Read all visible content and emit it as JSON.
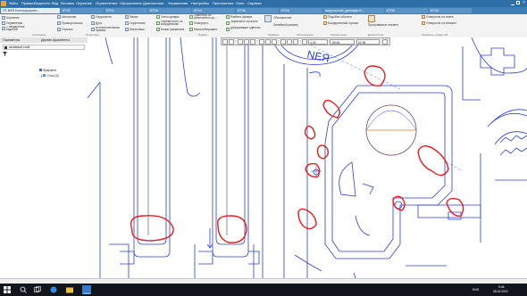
{
  "menubar": {
    "items": [
      "Файл",
      "Правка",
      "Выделить",
      "Вид",
      "Вставка",
      "Черчение",
      "Ограничения",
      "Оформление",
      "Диагностика",
      "Управление",
      "Настройка",
      "Приложения",
      "Окно",
      "Справка"
    ]
  },
  "tabs": [
    {
      "label": "ПТ-ВФП Конструкционн..."
    },
    {
      "label": "КТЭ3"
    },
    {
      "label": "КТЭ1"
    },
    {
      "label": "КТЭ6"
    },
    {
      "label": "КТЭ4"
    },
    {
      "label": "КТЭ6"
    },
    {
      "label": "КТЭ4"
    },
    {
      "label": "нагрузочный_демпфер К..."
    },
    {
      "label": "КТЭ5"
    },
    {
      "label": "КТЭ4"
    }
  ],
  "ribbon": {
    "left_tools": [
      "Черчение",
      "Управление",
      "Стандартные изделия"
    ],
    "col1": [
      "Автолиния",
      "Прямоугольник",
      "Отрезок"
    ],
    "col2": [
      "Окружность",
      "Дуга",
      "Вспомогательная прямая"
    ],
    "col3": [
      "Фаска",
      "Скругление",
      "Штриховка"
    ],
    "col4": [
      "Усечь кривую",
      "Переместить по координатам",
      "Копия указанием"
    ],
    "col5": [
      "Ориентир из реактивного ко...",
      "Повернуть",
      "Масштабировать"
    ],
    "col6": [
      "Разбить кривую",
      "Зеркально отразить",
      "Деформация сдвигом"
    ],
    "col7": [
      "Обозначение",
      "Линейный размер"
    ],
    "col8": [
      "Подобие объекта",
      "Координатный ограничитель"
    ],
    "col9": [
      "Программные элементы"
    ],
    "col10": [
      "Отверстие на плате",
      "Отверстие на элемент"
    ],
    "group_titles": [
      "Системная",
      "Геометрия",
      "Правка",
      "Размеры",
      "Обозначения",
      "Ограничения",
      "Диагностика",
      "Элементы отверстий"
    ]
  },
  "left_panel": {
    "panel_title": "Параметры",
    "fragment_title": "Дерево фрагмента",
    "layer_value": "активный слой",
    "tree_root": "Фрагмент",
    "tree_child": "Слои (0)"
  },
  "float_toolbar": {
    "angle_value": "4,09",
    "x_value": "-59,65",
    "y_value": "62,98"
  },
  "canvas": {
    "letters": "NEЯ"
  },
  "taskbar": {
    "lang": "ENG",
    "time": "9:48",
    "date": "08.04.2019"
  },
  "colors": {
    "drawing": "#2b3fd1",
    "circle_orange": "#e07b1e",
    "annotation_red": "#e02020",
    "menubar": "#2f6fa8",
    "taskbar": "#12161c"
  }
}
